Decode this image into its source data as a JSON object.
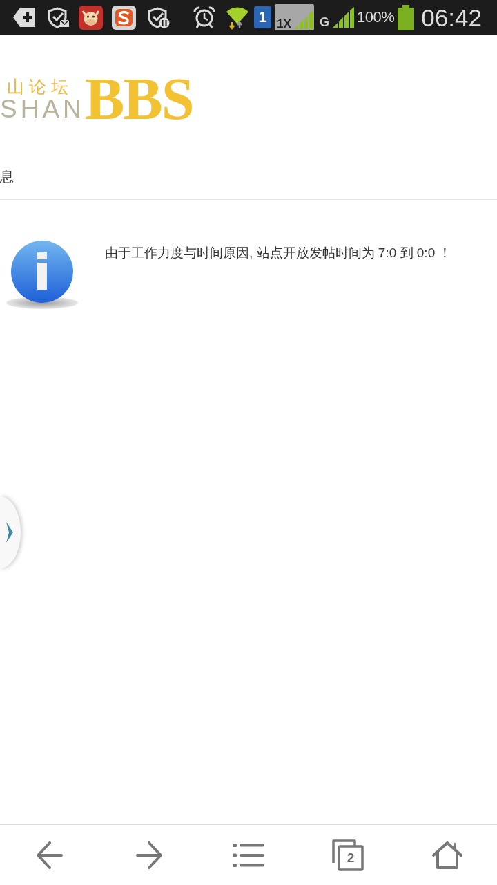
{
  "status_bar": {
    "sim_slot": "1",
    "network_badge": "1X",
    "network_type": "G",
    "battery": "100%",
    "time": "06:42"
  },
  "header": {
    "logo": {
      "chinese_text": "山论坛",
      "latin_text": "SHAN",
      "mark_text": "BBS"
    },
    "nav_label": "息"
  },
  "message": {
    "text": "由于工作力度与时间原因, 站点开放发帖时间为 7:0 到 0:0 ！"
  },
  "toolbar": {
    "tab_count": "2"
  }
}
